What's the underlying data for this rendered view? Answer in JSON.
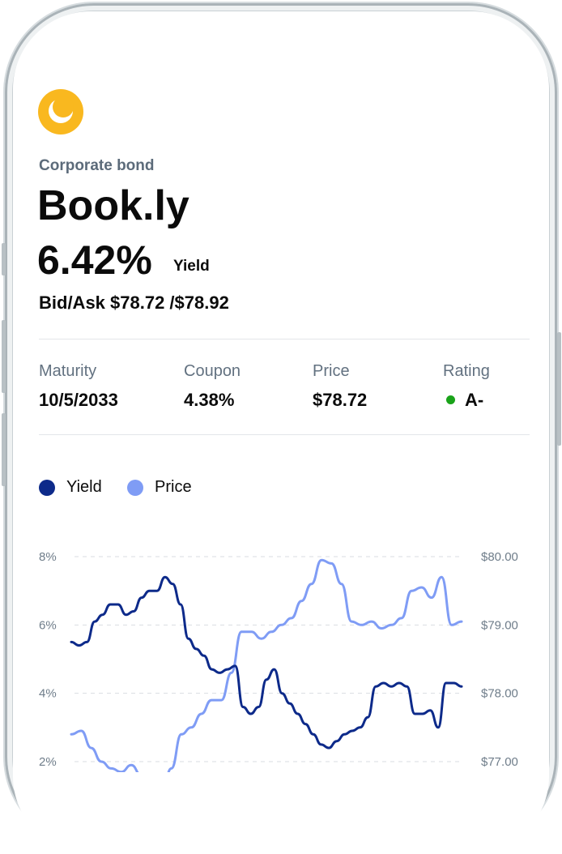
{
  "header": {
    "category": "Corporate bond",
    "name": "Book.ly",
    "yield_value": "6.42%",
    "yield_label": "Yield",
    "bid_ask": "Bid/Ask $78.72 /$78.92"
  },
  "stats": [
    {
      "label": "Maturity",
      "value": "10/5/2033"
    },
    {
      "label": "Coupon",
      "value": "4.38%"
    },
    {
      "label": "Price",
      "value": "$78.72"
    },
    {
      "label": "Rating",
      "value": "A-"
    }
  ],
  "colors": {
    "logo": "#f9b81f",
    "yield_series": "#0d2a8a",
    "price_series": "#7f9cf5",
    "rating_dot": "#1aa31a"
  },
  "chart_data": {
    "type": "line",
    "legend": [
      {
        "name": "Yield",
        "color": "#0d2a8a"
      },
      {
        "name": "Price",
        "color": "#7f9cf5"
      }
    ],
    "left_axis": {
      "ticks": [
        "8%",
        "6%",
        "4%",
        "2%"
      ],
      "values": [
        8,
        6,
        4,
        2
      ],
      "range": [
        2,
        8
      ]
    },
    "right_axis": {
      "ticks": [
        "$80.00",
        "$79.00",
        "$78.00",
        "$77.00"
      ],
      "values": [
        80,
        79,
        78,
        77
      ],
      "range": [
        77,
        80
      ]
    },
    "x": [
      0,
      1,
      2,
      3,
      4,
      5,
      6,
      7,
      8,
      9,
      10,
      11,
      12,
      13,
      14,
      15,
      16,
      17,
      18,
      19,
      20,
      21,
      22,
      23,
      24,
      25,
      26,
      27,
      28,
      29,
      30,
      31,
      32,
      33,
      34,
      35,
      36,
      37,
      38,
      39,
      40,
      41,
      42,
      43,
      44,
      45,
      46,
      47,
      48,
      49,
      50,
      51,
      52,
      53,
      54,
      55,
      56,
      57,
      58,
      59,
      60,
      61,
      62,
      63
    ],
    "series": [
      {
        "name": "Yield",
        "axis": "left",
        "values": [
          5.5,
          5.4,
          5.5,
          6.1,
          6.3,
          6.6,
          6.6,
          6.3,
          6.4,
          6.8,
          7.0,
          7.0,
          7.4,
          7.2,
          6.6,
          5.6,
          5.3,
          5.1,
          4.7,
          4.6,
          4.7,
          4.8,
          3.6,
          3.4,
          3.6,
          4.4,
          4.7,
          4.0,
          3.7,
          3.4,
          3.1,
          2.8,
          2.5,
          2.4,
          2.6,
          2.8,
          2.9,
          3.0,
          3.3,
          4.2,
          4.3,
          4.2,
          4.3,
          4.2,
          3.4,
          3.4,
          3.5,
          3.0,
          4.3,
          4.3,
          4.2
        ]
      },
      {
        "name": "Price",
        "axis": "right",
        "values": [
          77.4,
          77.45,
          77.2,
          77.0,
          76.9,
          76.85,
          76.95,
          76.8,
          76.6,
          76.5,
          76.9,
          77.4,
          77.5,
          77.7,
          77.9,
          77.9,
          78.3,
          78.9,
          78.9,
          78.8,
          78.9,
          79.0,
          79.1,
          79.35,
          79.6,
          79.95,
          79.9,
          79.6,
          79.05,
          79.0,
          79.05,
          78.95,
          79.0,
          79.1,
          79.5,
          79.55,
          79.4,
          79.7,
          79.0,
          79.05
        ]
      }
    ]
  }
}
